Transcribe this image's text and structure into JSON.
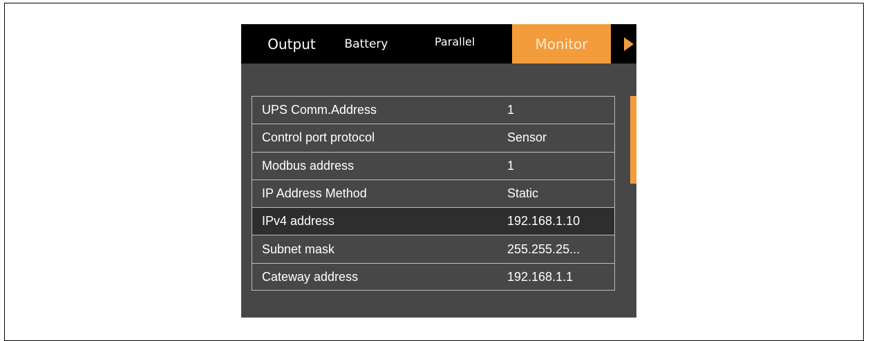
{
  "tabs": {
    "output": "Output",
    "battery": "Battery",
    "parallel": "Parallel",
    "monitor": "Monitor",
    "active": "Monitor",
    "next_icon": "play-right-icon"
  },
  "settings": [
    {
      "label": "UPS Comm.Address",
      "value": "1"
    },
    {
      "label": "Control port protocol",
      "value": "Sensor"
    },
    {
      "label": "Modbus address",
      "value": "1"
    },
    {
      "label": "IP Address Method",
      "value": "Static"
    },
    {
      "label": "IPv4 address",
      "value": "192.168.1.10"
    },
    {
      "label": "Subnet mask",
      "value": "255.255.25..."
    },
    {
      "label": "Cateway address",
      "value": "192.168.1.1"
    }
  ],
  "selected_row": "IPv4 address",
  "colors": {
    "accent": "#f39c3c",
    "background": "#474747",
    "tabbar": "#000000",
    "selected_row": "#2e2e2e",
    "text": "#ffffff"
  }
}
